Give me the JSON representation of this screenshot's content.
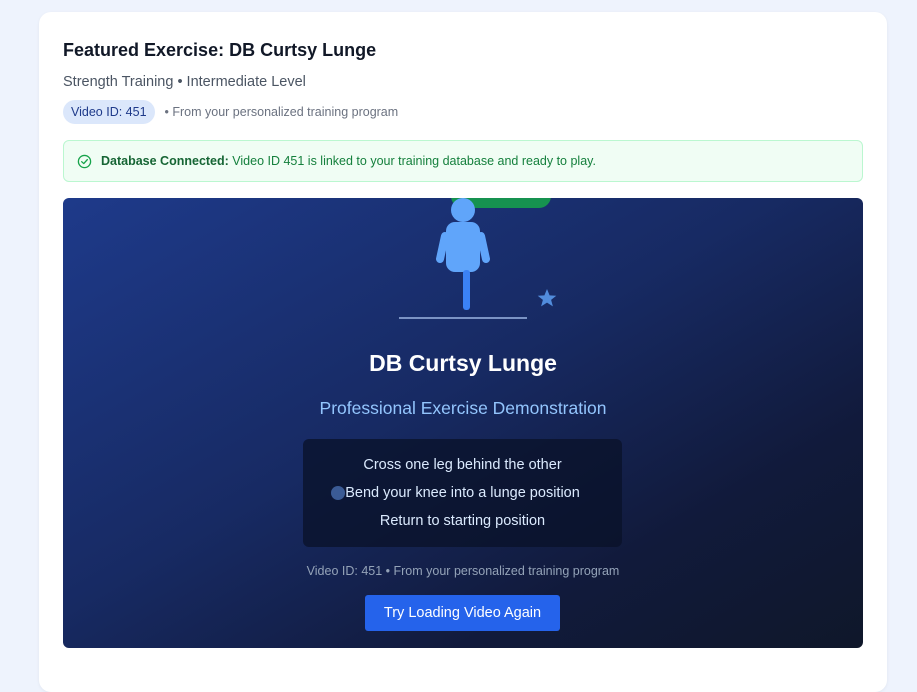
{
  "card": {
    "title": "Featured Exercise: DB Curtsy Lunge",
    "subtitle": "Strength Training • Intermediate Level",
    "badge": "Video ID: 451",
    "meta": "• From your personalized training program"
  },
  "status": {
    "icon": "check-circle-icon",
    "label": "Database Connected:",
    "message": " Video ID 451 is linked to your training database and ready to play.",
    "color": "#15803d"
  },
  "player": {
    "exercise_name": "DB Curtsy Lunge",
    "subtitle": "Professional Exercise Demonstration",
    "steps": [
      "Cross one leg behind the other",
      "Bend your knee into a lunge position",
      "Return to starting position"
    ],
    "footer": "Video ID: 451 • From your personalized training program",
    "retry_label": "Try Loading Video Again",
    "accent": "#2563eb"
  }
}
